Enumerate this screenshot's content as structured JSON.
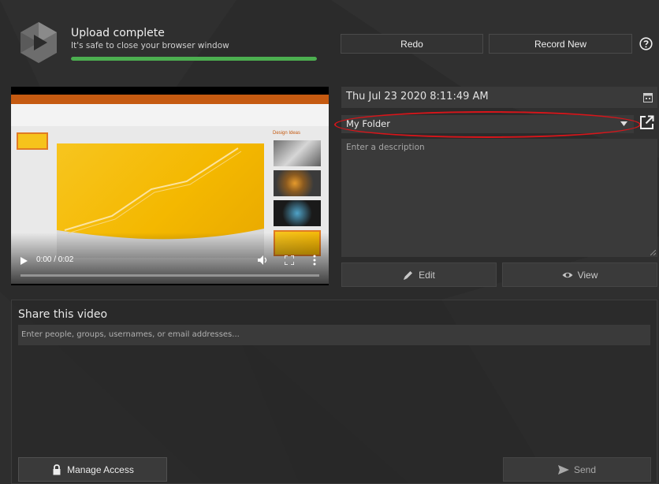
{
  "header": {
    "status_title": "Upload complete",
    "status_subtitle": "It's safe to close your browser window",
    "progress_fraction": 1.0,
    "redo_label": "Redo",
    "record_new_label": "Record New"
  },
  "player": {
    "time_display": "0:00 / 0:02",
    "slide_panel_title": "Design Ideas"
  },
  "recording": {
    "date_value": "Thu Jul 23 2020 8:11:49 AM",
    "folder_selected": "My Folder",
    "description_placeholder": "Enter a description",
    "edit_label": "Edit",
    "view_label": "View"
  },
  "share": {
    "title": "Share this video",
    "input_placeholder": "Enter people, groups, usernames, or email addresses...",
    "manage_access_label": "Manage Access",
    "send_label": "Send"
  },
  "icons": {
    "logo": "panopto-logo-icon",
    "help": "help-icon",
    "calendar": "calendar-icon",
    "open_external": "open-external-icon",
    "edit": "pencil-icon",
    "view": "eye-icon",
    "lock": "lock-icon",
    "send": "send-icon"
  },
  "colors": {
    "background": "#2b2b2b",
    "field": "#3a3a3a",
    "progress": "#4caf50",
    "highlight_annotation": "#d8151a",
    "slide_accent": "#f4b800"
  }
}
